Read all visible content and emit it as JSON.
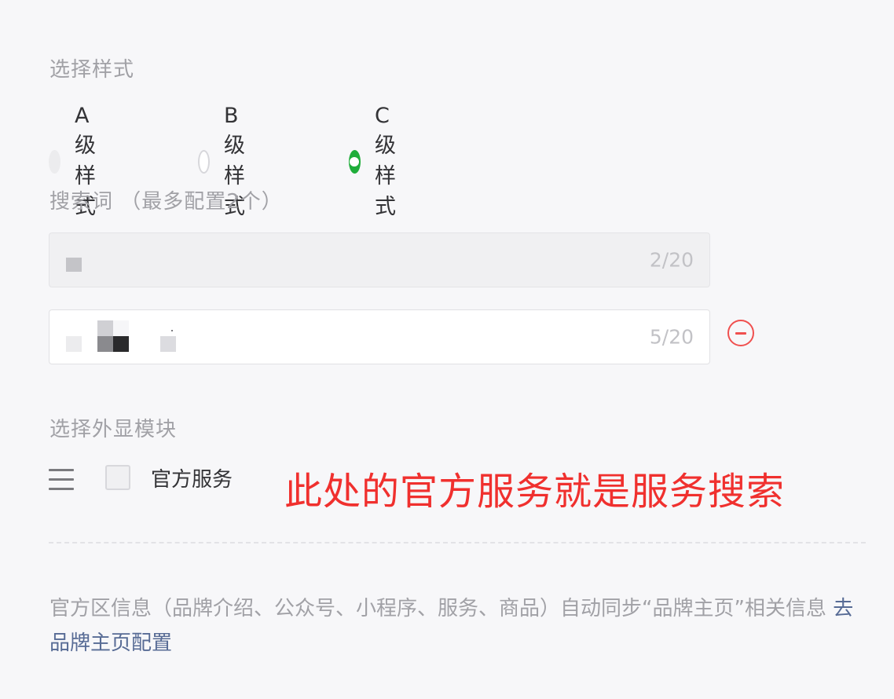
{
  "style_section": {
    "label": "选择样式",
    "options": [
      {
        "label": "A级样式",
        "state": "disabled"
      },
      {
        "label": "B级样式",
        "state": "unchecked"
      },
      {
        "label": "C级样式",
        "state": "checked"
      }
    ]
  },
  "keywords_section": {
    "label": "搜索词 （最多配置2个）",
    "inputs": [
      {
        "counter": "2/20",
        "state": "disabled"
      },
      {
        "counter": "5/20",
        "state": "active"
      }
    ]
  },
  "modules_section": {
    "label": "选择外显模块",
    "items": [
      {
        "label": "官方服务",
        "checked": false
      }
    ],
    "annotation": "此处的官方服务就是服务搜索"
  },
  "footer": {
    "note": "官方区信息（品牌介绍、公众号、小程序、服务、商品）自动同步“品牌主页”相关信息",
    "link_label": "去品牌主页配置"
  },
  "colors": {
    "accent_green": "#1fad3a",
    "danger_red": "#f0504f",
    "link_blue": "#576b95",
    "annotation_red": "#f0302e"
  },
  "icons": {
    "remove": "minus-circle-icon",
    "drag": "drag-handle-icon"
  }
}
